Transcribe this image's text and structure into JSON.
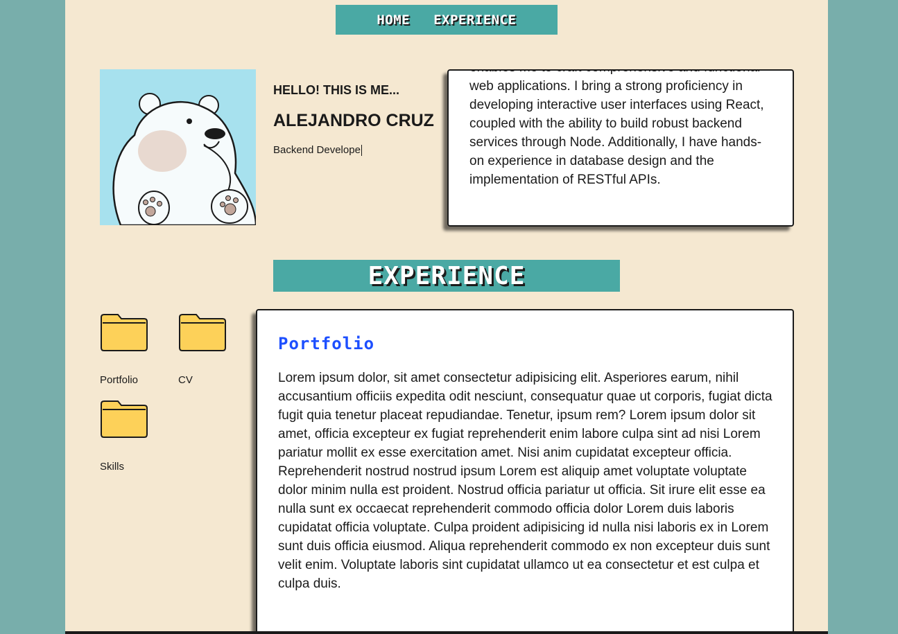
{
  "nav": {
    "items": [
      {
        "label": "HOME"
      },
      {
        "label": "EXPERIENCE"
      }
    ]
  },
  "profile": {
    "greeting": "HELLO! THIS IS ME...",
    "name": "ALEJANDRO CRUZ",
    "role": "Backend Develope"
  },
  "about": {
    "text": "enables me to craft comprehensive and functional web applications. I bring a strong proficiency in developing interactive user interfaces using React, coupled with the ability to build robust backend services through Node. Additionally, I have hands-on experience in database design and the implementation of RESTful APIs."
  },
  "experience": {
    "heading": "EXPERIENCE",
    "folders": [
      {
        "label": "Portfolio",
        "icon": "folder-icon"
      },
      {
        "label": "CV",
        "icon": "folder-icon"
      },
      {
        "label": "Skills",
        "icon": "folder-icon"
      }
    ],
    "card": {
      "title": "Portfolio",
      "body": "Lorem ipsum dolor, sit amet consectetur adipisicing elit. Asperiores earum, nihil accusantium officiis expedita odit nesciunt, consequatur quae ut corporis, fugiat dicta fugit quia tenetur placeat repudiandae. Tenetur, ipsum rem? Lorem ipsum dolor sit amet, officia excepteur ex fugiat reprehenderit enim labore culpa sint ad nisi Lorem pariatur mollit ex esse exercitation amet. Nisi anim cupidatat excepteur officia. Reprehenderit nostrud nostrud ipsum Lorem est aliquip amet voluptate voluptate dolor minim nulla est proident. Nostrud officia pariatur ut officia. Sit irure elit esse ea nulla sunt ex occaecat reprehenderit commodo officia dolor Lorem duis laboris cupidatat officia voluptate. Culpa proident adipisicing id nulla nisi laboris ex in Lorem sunt duis officia eiusmod. Aliqua reprehenderit commodo ex non excepteur duis sunt velit enim. Voluptate laboris sint cupidatat ullamco ut ea consectetur et est culpa et culpa duis."
    }
  },
  "colors": {
    "background": "#78aeab",
    "page": "#f5e8d1",
    "accent": "#4aa9a4",
    "folder": "#fdd159",
    "card_title": "#1d4fff"
  }
}
